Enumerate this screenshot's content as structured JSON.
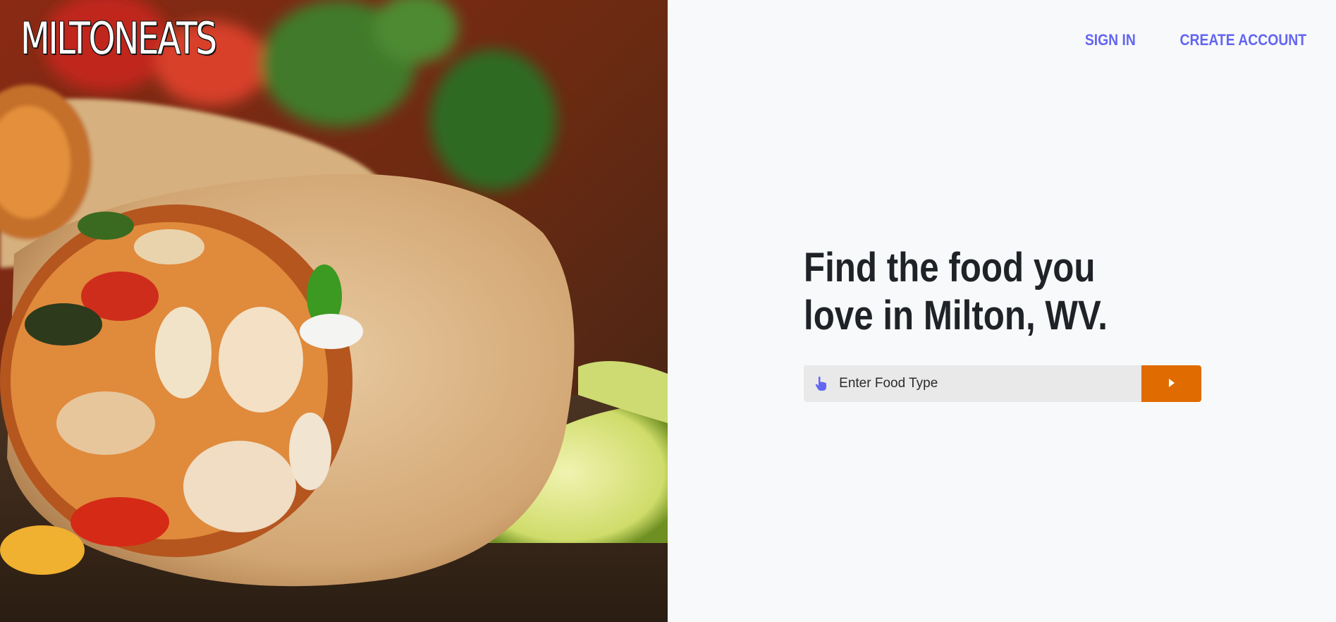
{
  "brand": {
    "logo": "MILTONEATS"
  },
  "nav": {
    "sign_in": "SIGN IN",
    "create_account": "CREATE ACCOUNT"
  },
  "hero": {
    "headline": "Find the food you love in Milton, WV."
  },
  "search": {
    "placeholder": "Enter Food Type",
    "value": "",
    "icon": "pointing-hand-icon",
    "submit_icon": "play-arrow-icon"
  },
  "colors": {
    "accent": "#6366f1",
    "button": "#e06b00",
    "headline": "#1f2328",
    "background": "#f8f9fb",
    "input_bg": "#e9e9ea"
  }
}
